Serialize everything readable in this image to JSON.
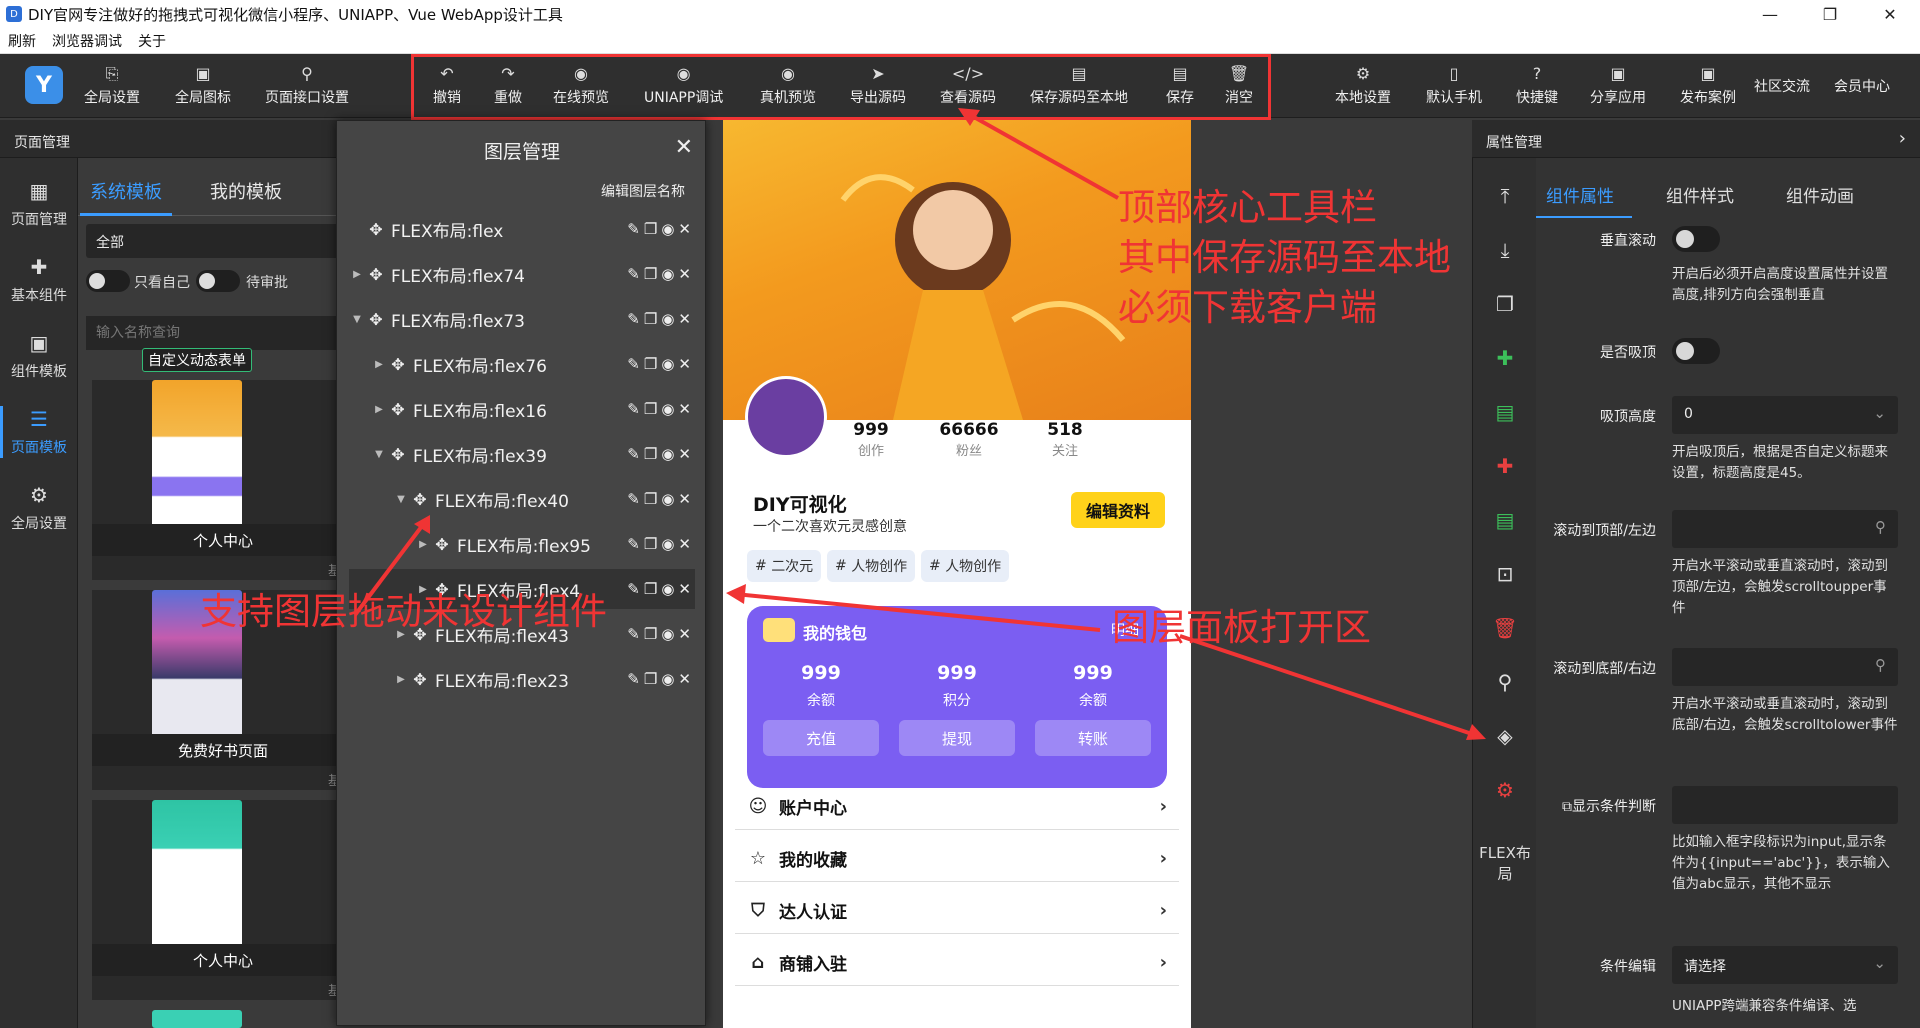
{
  "window": {
    "title": "DIY官网专注做好的拖拽式可视化微信小程序、UNIAPP、Vue WebApp设计工具",
    "controls": [
      "—",
      "❐",
      "✕"
    ]
  },
  "menu": [
    "刷新",
    "浏览器调试",
    "关于"
  ],
  "toolbar": {
    "left": [
      "全局设置",
      "全局图标",
      "页面接口设置"
    ],
    "center": [
      "撤销",
      "重做",
      "在线预览",
      "UNIAPP调试",
      "真机预览",
      "导出源码",
      "查看源码",
      "保存源码至本地",
      "保存",
      "消空"
    ],
    "right": [
      "本地设置",
      "默认手机",
      "快捷键",
      "分享应用",
      "发布案例",
      "社区交流",
      "会员中心"
    ]
  },
  "left": {
    "header": "页面管理",
    "nav": [
      "页面管理",
      "基本组件",
      "组件模板",
      "页面模板",
      "全局设置"
    ],
    "tabs": [
      "系统模板",
      "我的模板"
    ],
    "filter_value": "全部",
    "switches": [
      "只看自己",
      "待审批"
    ],
    "search_placeholder": "输入名称查询",
    "cards": [
      {
        "name": "自定义动态表单",
        "tag": ""
      },
      {
        "name": "个人中心",
        "tag": "基础"
      },
      {
        "name": "免费好书页面",
        "tag": "基础"
      },
      {
        "name": "个人中心",
        "tag": "基础"
      }
    ]
  },
  "layers": {
    "title": "图层管理",
    "edit_label": "编辑图层名称",
    "items": [
      {
        "name": "FLEX布局:flex",
        "arrow": ""
      },
      {
        "name": "FLEX布局:flex74",
        "arrow": "▶"
      },
      {
        "name": "FLEX布局:flex73",
        "arrow": "▼"
      },
      {
        "name": "FLEX布局:flex76",
        "arrow": "▶"
      },
      {
        "name": "FLEX布局:flex16",
        "arrow": "▶"
      },
      {
        "name": "FLEX布局:flex39",
        "arrow": "▼"
      },
      {
        "name": "FLEX布局:flex40",
        "arrow": "▼"
      },
      {
        "name": "FLEX布局:flex95",
        "arrow": "▶"
      },
      {
        "name": "FLEX布局:flex4",
        "arrow": "▶"
      },
      {
        "name": "FLEX布局:flex43",
        "arrow": "▶"
      },
      {
        "name": "FLEX布局:flex23",
        "arrow": "▶"
      }
    ]
  },
  "phone": {
    "stats": [
      {
        "value": "999",
        "label": "创作"
      },
      {
        "value": "66666",
        "label": "粉丝"
      },
      {
        "value": "518",
        "label": "关注"
      }
    ],
    "nickname": "DIY可视化",
    "slogan": "一个二次喜欢元灵感创意",
    "edit_btn": "编辑资料",
    "tags": [
      "二次元",
      "人物创作",
      "人物创作"
    ],
    "wallet": {
      "title": "我的钱包",
      "detail": "明细",
      "items": [
        {
          "value": "999",
          "label": "余额",
          "btn": "充值"
        },
        {
          "value": "999",
          "label": "积分",
          "btn": "提现"
        },
        {
          "value": "999",
          "label": "余额",
          "btn": "转账"
        }
      ]
    },
    "menus": [
      "账户中心",
      "我的收藏",
      "达人认证",
      "商铺入驻"
    ]
  },
  "annotations": {
    "toolbar": [
      "顶部核心工具栏",
      "其中保存源码至本地",
      "必须下载客户端"
    ],
    "drag": "支持图层拖动来设计组件",
    "panel": "图层面板打开区"
  },
  "right": {
    "header": "属性管理",
    "tabs": [
      "组件属性",
      "组件样式",
      "组件动画"
    ],
    "flex_label": "FLEX布局",
    "props": {
      "vertical_scroll": "垂直滚动",
      "vertical_desc": "开启后必须开启高度设置属性并设置高度,排列方向会强制垂直",
      "sticky": "是否吸顶",
      "sticky_height": "吸顶高度",
      "sticky_height_value": "0",
      "sticky_desc": "开启吸顶后，根据是否自定义标题来设置，标题高度是45。",
      "scroll_top": "滚动到顶部/左边",
      "scroll_top_desc": "开启水平滚动或垂直滚动时，滚动到顶部/左边，会触发scrolltoupper事件",
      "scroll_bottom": "滚动到底部/右边",
      "scroll_bottom_desc": "开启水平滚动或垂直滚动时，滚动到底部/右边，会触发scrolltolower事件",
      "condition": "显示条件判断",
      "condition_desc": "比如输入框字段标识为input,显示条件为{{input=='abc'}}，表示输入值为abc显示，其他不显示",
      "cond_edit": "条件编辑",
      "cond_edit_value": "请选择",
      "bottom_text": "UNIAPP跨端兼容条件编译、选"
    }
  },
  "colors": {
    "accent": "#3b9cff",
    "annotation": "#f03434",
    "wallet": "#7b5ef2",
    "edit_btn": "#ffd21a"
  }
}
